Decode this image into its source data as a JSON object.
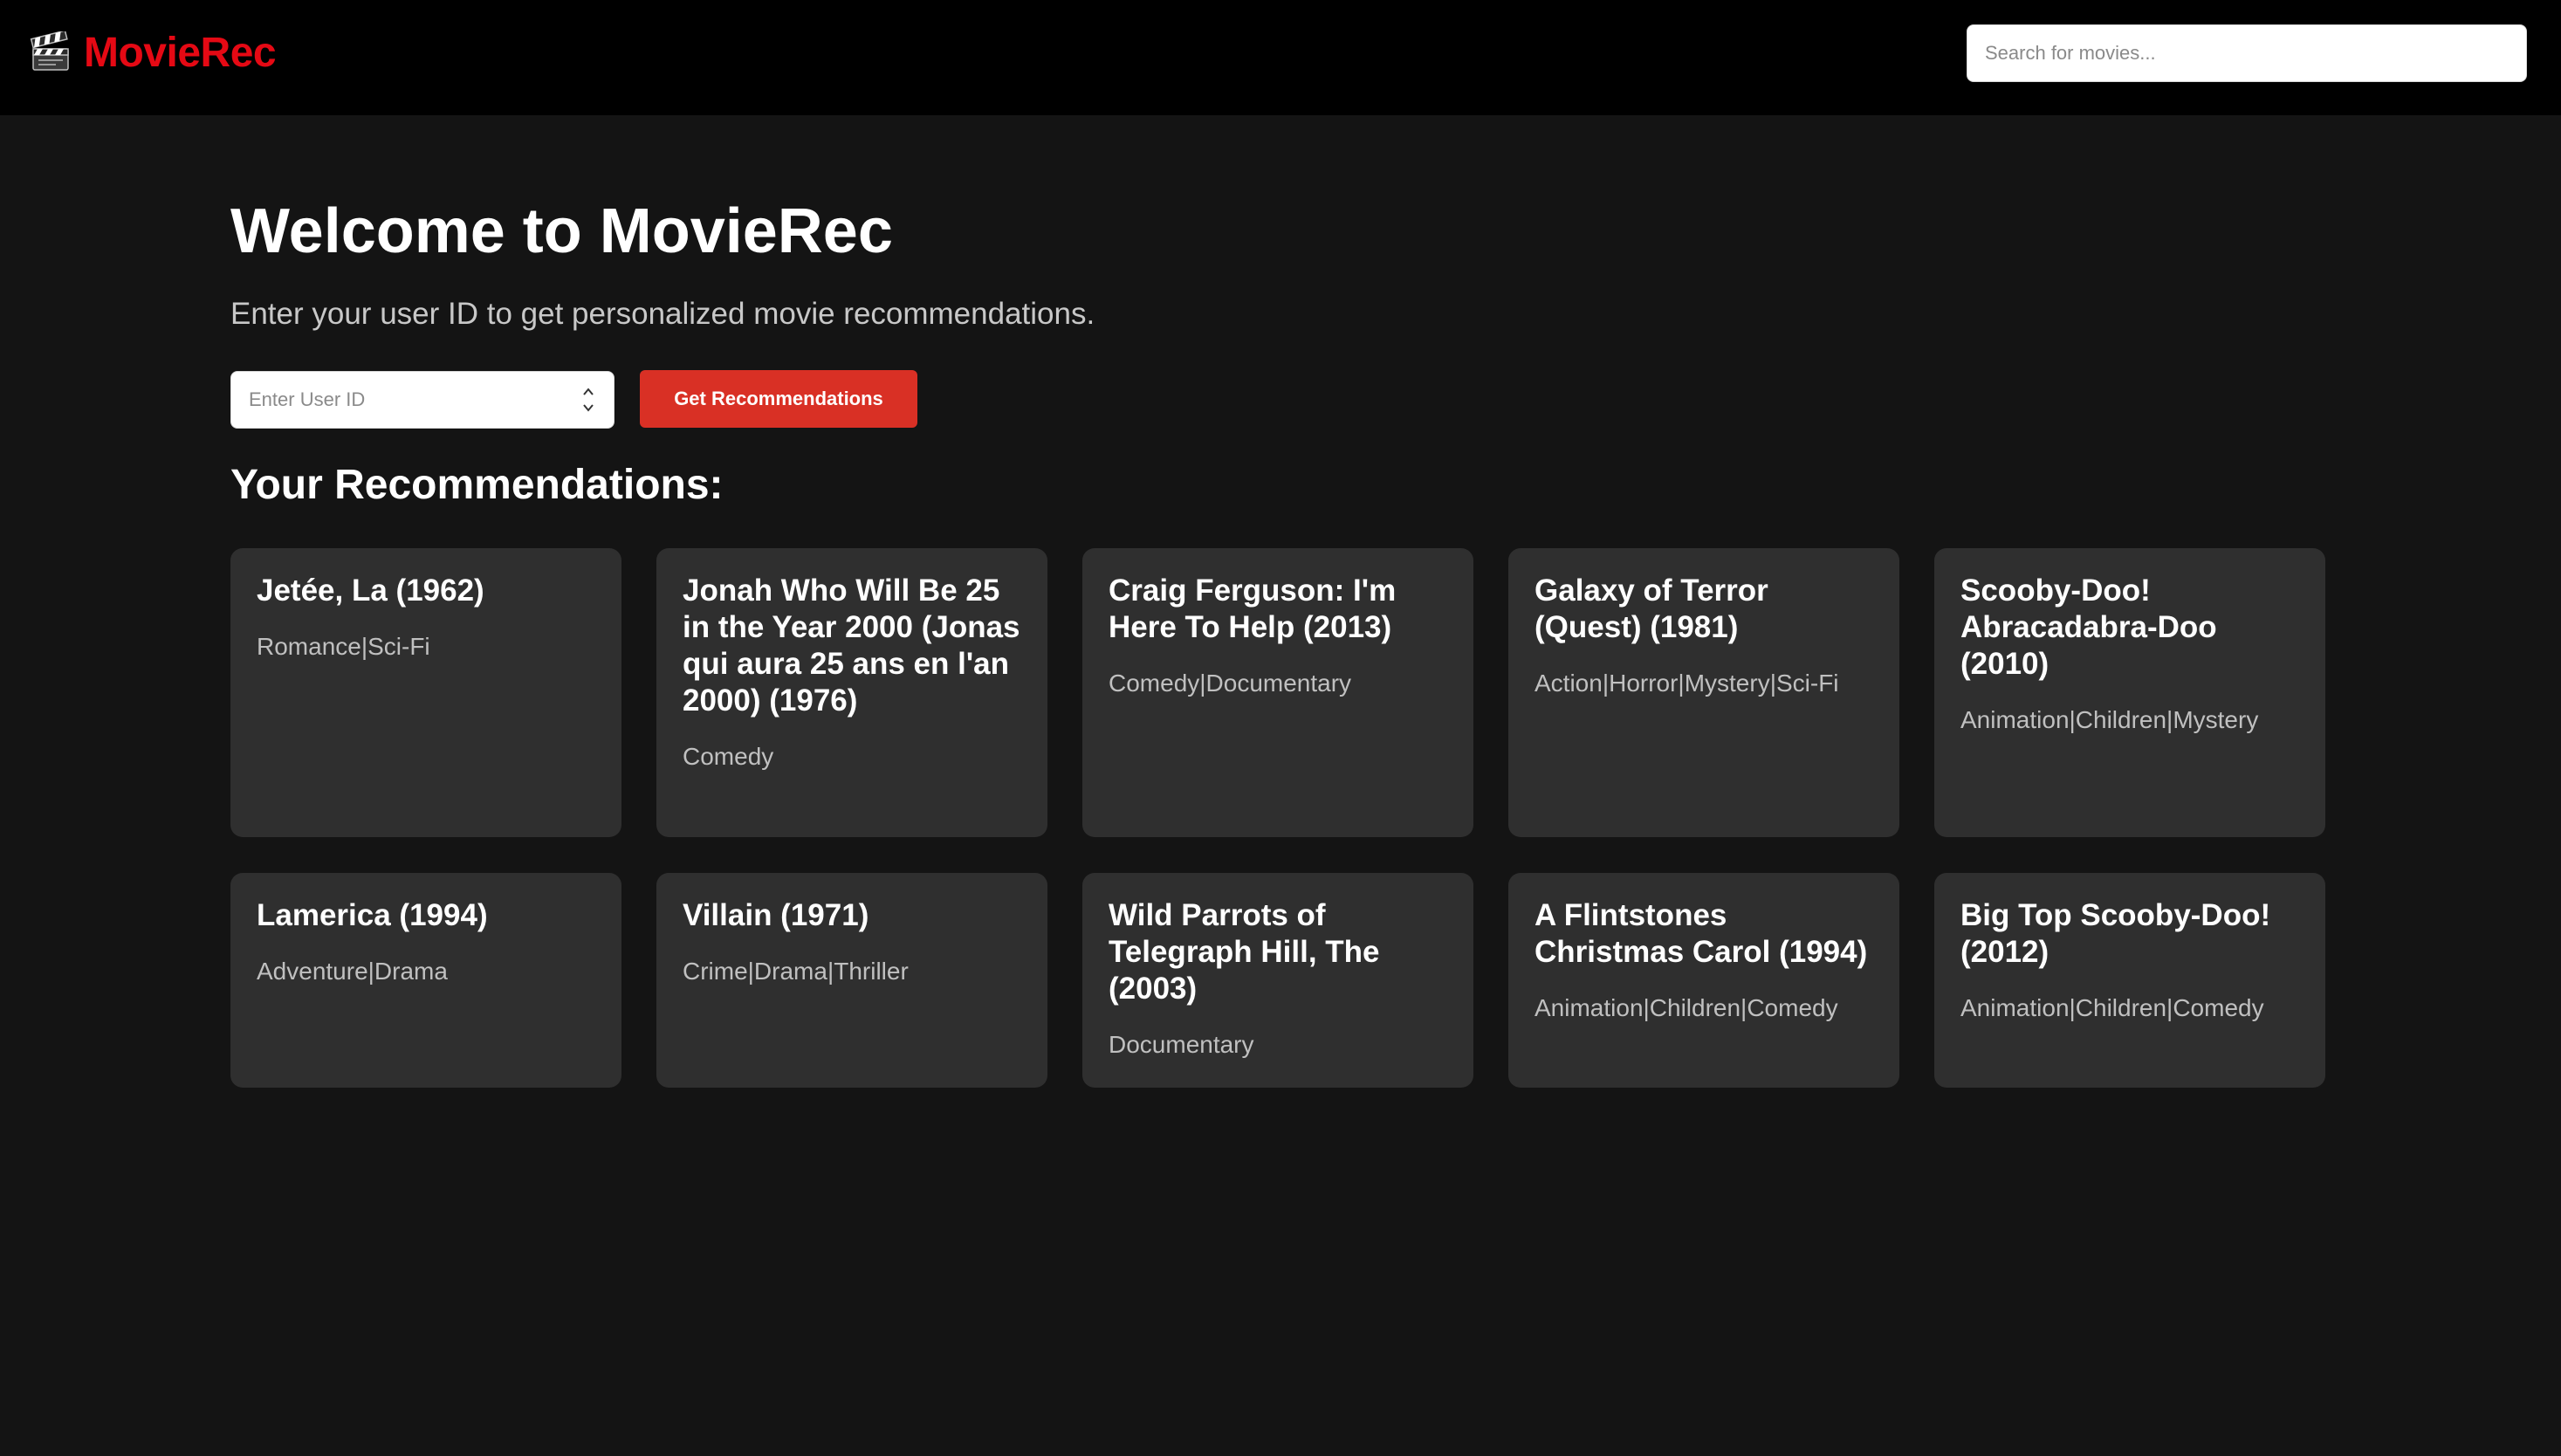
{
  "header": {
    "brand_icon": "clapperboard-icon",
    "brand_name": "MovieRec",
    "search_placeholder": "Search for movies..."
  },
  "colors": {
    "brand": "#e50914",
    "button": "#d93025",
    "page_background": "#141414",
    "card_background": "#2f2f2f"
  },
  "main": {
    "title": "Welcome to MovieRec",
    "subtitle": "Enter your user ID to get personalized movie recommendations.",
    "user_id_placeholder": "Enter User ID",
    "get_recommendations_label": "Get Recommendations",
    "section_title": "Your Recommendations:"
  },
  "recommendations": [
    {
      "title": "Jetée, La (1962)",
      "genres": "Romance|Sci-Fi"
    },
    {
      "title": "Jonah Who Will Be 25 in the Year 2000 (Jonas qui aura 25 ans en l'an 2000) (1976)",
      "genres": "Comedy"
    },
    {
      "title": "Craig Ferguson: I'm Here To Help (2013)",
      "genres": "Comedy|Documentary"
    },
    {
      "title": "Galaxy of Terror (Quest) (1981)",
      "genres": "Action|Horror|Mystery|Sci-Fi"
    },
    {
      "title": "Scooby-Doo! Abracadabra-Doo (2010)",
      "genres": "Animation|Children|Mystery"
    },
    {
      "title": "Lamerica (1994)",
      "genres": "Adventure|Drama"
    },
    {
      "title": "Villain (1971)",
      "genres": "Crime|Drama|Thriller"
    },
    {
      "title": "Wild Parrots of Telegraph Hill, The (2003)",
      "genres": "Documentary"
    },
    {
      "title": "A Flintstones Christmas Carol (1994)",
      "genres": "Animation|Children|Comedy"
    },
    {
      "title": "Big Top Scooby-Doo! (2012)",
      "genres": "Animation|Children|Comedy"
    }
  ]
}
